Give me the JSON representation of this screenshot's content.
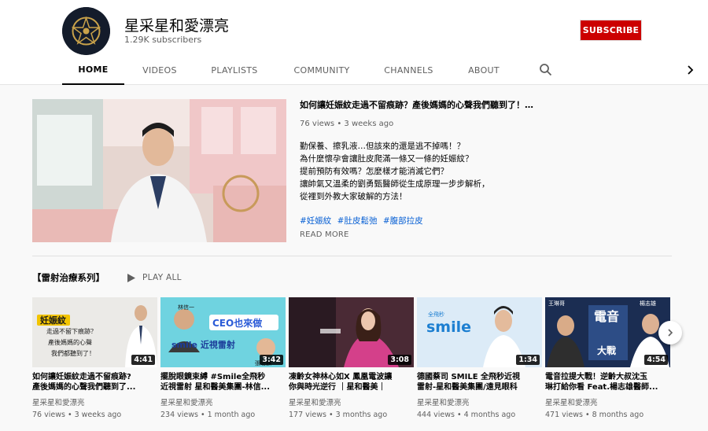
{
  "channel": {
    "name": "星采星和愛漂亮",
    "subscribers": "1.29K subscribers",
    "subscribe_label": "SUBSCRIBE",
    "avatar_icon": "star-logo-icon"
  },
  "tabs": [
    "HOME",
    "VIDEOS",
    "PLAYLISTS",
    "COMMUNITY",
    "CHANNELS",
    "ABOUT"
  ],
  "featured": {
    "title": "如何讓妊娠紋走過不留痕跡？產後媽媽的心聲我們聽到了！▌...",
    "meta": "76 views • 3 weeks ago",
    "description": [
      "勤保養、擦乳液…但該來的還是逃不掉嗎！？",
      "為什麼懷孕會讓肚皮爬滿一條又一條的妊娠紋？",
      "提前預防有效嗎？怎麼樣才能消滅它們？",
      "讓帥氣又溫柔的劉勇甄醫師從生成原理一步步解析，",
      "從裡到外教大家破解的方法！"
    ],
    "hashtags": [
      "#妊娠紋",
      "#肚皮鬆弛",
      "#腹部拉皮"
    ],
    "read_more": "READ MORE"
  },
  "playlist": {
    "title": "【雷射治療系列】",
    "play_all": "PLAY ALL",
    "videos": [
      {
        "title1": "如何讓妊娠紋走過不留痕跡?",
        "title2": "產後媽媽的心聲我們聽到了...",
        "channel": "星采星和愛漂亮",
        "meta": "76 views • 3 weeks ago",
        "duration": "4:41",
        "thumb": {
          "line1": "妊娠紋",
          "line2": "走過不留下痕跡？",
          "line3": "產後媽媽的心聲",
          "line4": "我們都聽到了！"
        }
      },
      {
        "title1": "擺脫眼鏡束縛 #Smile全飛秒",
        "title2": "近視雷射 星和醫美集團-林信...",
        "channel": "星采星和愛漂亮",
        "meta": "234 views • 1 month ago",
        "duration": "3:42",
        "thumb": {
          "line1": "CEO也來做",
          "line2": "smile 近視雷射",
          "line3": "林信一",
          "line4": "張聰麒"
        }
      },
      {
        "title1": "凍齡女神林心如X 鳳凰電波讓",
        "title2": "你與時光逆行 ｜星和醫美｜",
        "channel": "星采星和愛漂亮",
        "meta": "177 views • 3 months ago",
        "duration": "3:08",
        "thumb": {
          "line1": "",
          "line2": "",
          "line3": "",
          "line4": ""
        }
      },
      {
        "title1": "德國蔡司 SMILE 全飛秒近視",
        "title2": "雷射-星和醫美集團/遠見眼科",
        "channel": "星采星和愛漂亮",
        "meta": "444 views • 4 months ago",
        "duration": "1:34",
        "thumb": {
          "line1": "smile",
          "line2": "全飛秒",
          "line3": "",
          "line4": ""
        }
      },
      {
        "title1": "電音拉提大戰！逆齡大叔沈玉",
        "title2": "琳打給你看 Feat.楊志雄醫師...",
        "channel": "星采星和愛漂亮",
        "meta": "471 views • 8 months ago",
        "duration": "4:54",
        "thumb": {
          "line1": "王琳哥",
          "line2": "電音",
          "line3": "楊志雄",
          "line4": "大戰"
        }
      }
    ]
  },
  "colors": {
    "subscribe_bg": "#cc0000",
    "link": "#065fd4",
    "secondary_text": "#606060"
  }
}
